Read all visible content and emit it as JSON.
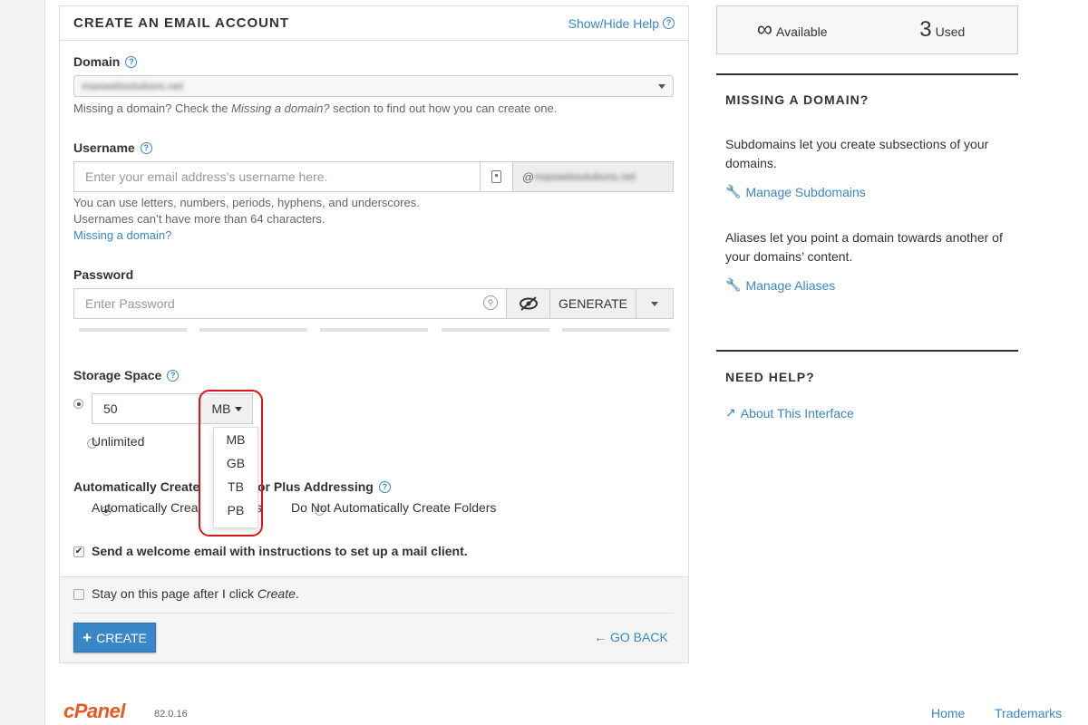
{
  "colors": {
    "accent": "#3a87c8",
    "brand": "#e85a24",
    "highlight": "#d9171a"
  },
  "panel": {
    "title": "CREATE AN EMAIL ACCOUNT",
    "help_toggle": "Show/Hide Help",
    "help_icon": "question-circle-icon"
  },
  "domain": {
    "label": "Domain",
    "value": "maxwebsolutions.net",
    "help": "Missing a domain? Check the ",
    "help_em": "Missing a domain?",
    "help_tail": " section to find out how you can create one."
  },
  "username": {
    "label": "Username",
    "placeholder": "Enter your email address’s username here.",
    "suffix_at": "@",
    "suffix_domain": "maxwebsolutions.net",
    "help_line1": "You can use letters, numbers, periods, hyphens, and underscores.",
    "help_line2": "Usernames can’t have more than 64 characters.",
    "missing_link": "Missing a domain?"
  },
  "password": {
    "label": "Password",
    "placeholder": "Enter Password",
    "generate": "GENERATE",
    "strength_segments": 5
  },
  "storage": {
    "label": "Storage Space",
    "value": "50",
    "unit": "MB",
    "unlimited": "Unlimited",
    "unit_options": [
      "MB",
      "GB",
      "TB",
      "PB"
    ]
  },
  "plus_addressing": {
    "label_start": "Automatically Create",
    "label_end": "or Plus Addressing",
    "option_create": "Automatically Crea",
    "option_create_tail": "s",
    "option_not": "Do Not Automatically Create Folders"
  },
  "welcome_email": {
    "label": "Send a welcome email with instructions to set up a mail client.",
    "checked": true
  },
  "stay": {
    "label": "Stay on this page after I click ",
    "label_em": "Create",
    "label_tail": "."
  },
  "actions": {
    "create": "CREATE",
    "go_back": "GO BACK"
  },
  "stats": {
    "available_num": "∞",
    "available_label": "Available",
    "used_num": "3",
    "used_label": "Used"
  },
  "sidebar": {
    "missing_title": "MISSING A DOMAIN?",
    "subdomains_text": "Subdomains let you create subsections of your domains.",
    "subdomains_link": "Manage Subdomains",
    "aliases_text": "Aliases let you point a domain towards another of your domains’ content.",
    "aliases_link": "Manage Aliases",
    "help_title": "NEED HELP?",
    "about_link": "About This Interface"
  },
  "footer": {
    "brand": "cPanel",
    "version": "82.0.16",
    "home": "Home",
    "trademarks": "Trademarks"
  }
}
